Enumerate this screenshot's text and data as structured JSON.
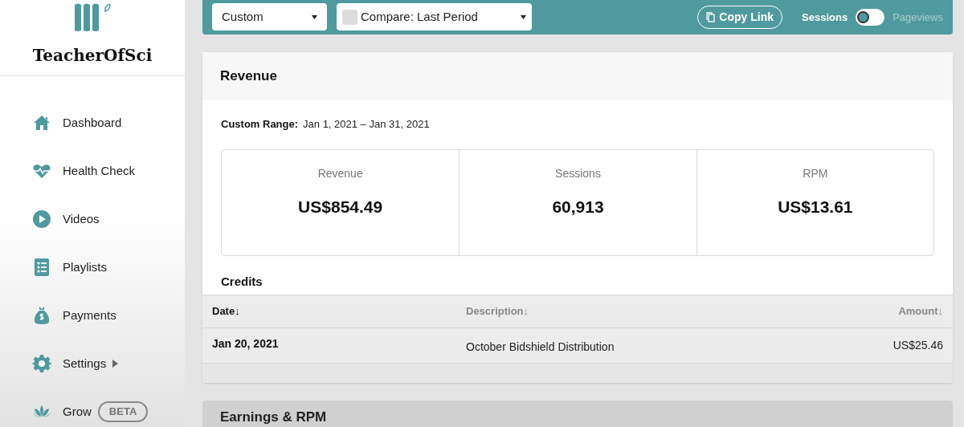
{
  "sidebar": {
    "brand": "TeacherOfSci",
    "items": [
      {
        "label": "Dashboard"
      },
      {
        "label": "Health Check"
      },
      {
        "label": "Videos"
      },
      {
        "label": "Playlists"
      },
      {
        "label": "Payments"
      },
      {
        "label": "Settings",
        "submenu": true
      },
      {
        "label": "Grow",
        "badge": "BETA"
      }
    ]
  },
  "toolbar": {
    "range": "Custom",
    "compare": {
      "label": "Compare: Last Period",
      "checked": false
    },
    "copy_link": "Copy Link",
    "toggle": [
      {
        "label": "Sessions",
        "selected": true
      },
      {
        "label": "Pageviews",
        "selected": false
      }
    ]
  },
  "revenue": {
    "title": "Revenue",
    "range_label": "Custom Range:",
    "range": "Jan 1, 2021 – Jan 31, 2021",
    "stats": [
      {
        "label": "Revenue",
        "value": "US$854.49"
      },
      {
        "label": "Sessions",
        "value": "60,913"
      },
      {
        "label": "RPM",
        "value": "US$13.61"
      }
    ],
    "credits": {
      "title": "Credits",
      "columns": [
        {
          "label": "Date↓",
          "active": true
        },
        {
          "label": "Description↓",
          "active": false
        },
        {
          "label": "Amount↓",
          "active": false
        }
      ],
      "rows": [
        [
          "Jan 20, 2021",
          "October Bidshield Distribution",
          "US$25.46"
        ]
      ]
    }
  },
  "next_card": {
    "title": "Earnings & RPM"
  }
}
